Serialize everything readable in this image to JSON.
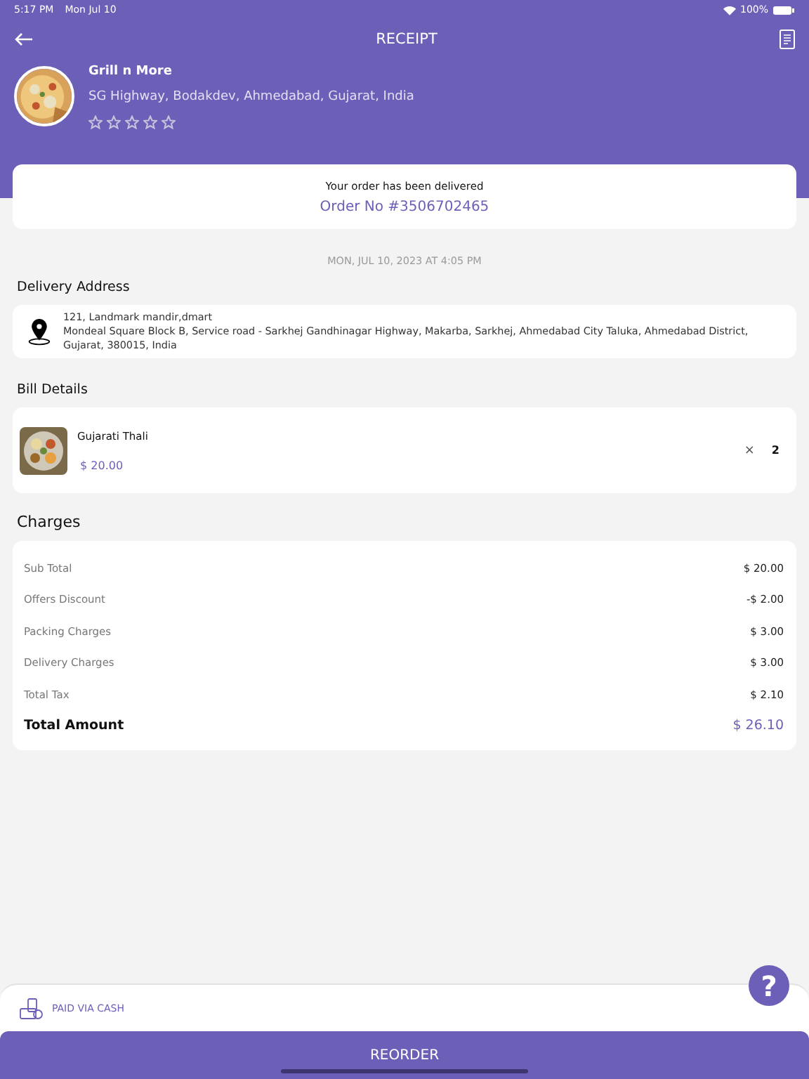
{
  "status_bar": {
    "time": "5:17 PM",
    "date": "Mon Jul 10",
    "battery": "100%"
  },
  "header": {
    "title": "RECEIPT"
  },
  "restaurant": {
    "name": "Grill n More",
    "address": "SG Highway, Bodakdev, Ahmedabad, Gujarat, India",
    "stars": 0
  },
  "order": {
    "status": "Your order has been delivered",
    "number": "Order No #3506702465",
    "date": "MON, JUL 10, 2023 AT 4:05 PM"
  },
  "delivery": {
    "heading": "Delivery Address",
    "lines": [
      "121, Landmark mandir,dmart",
      "Mondeal Square Block B, Service road - Sarkhej Gandhinagar Highway, Makarba, Sarkhej, Ahmedabad City Taluka, Ahmedabad District, Gujarat, 380015, India"
    ]
  },
  "bill": {
    "heading": "Bill Details",
    "items": [
      {
        "name": "Gujarati Thali",
        "price": "$ 20.00",
        "times": "×",
        "quantity": "2"
      }
    ]
  },
  "charges": {
    "heading": "Charges",
    "rows": [
      {
        "label": "Sub Total",
        "value": "$ 20.00"
      },
      {
        "label": "Offers Discount",
        "value": "-$ 2.00"
      },
      {
        "label": "Packing Charges",
        "value": "$ 3.00"
      },
      {
        "label": "Delivery Charges",
        "value": "$ 3.00"
      },
      {
        "label": "Total Tax",
        "value": "$ 2.10"
      }
    ],
    "total": {
      "label": "Total Amount",
      "value": "$ 26.10"
    }
  },
  "payment": {
    "label": "PAID VIA CASH"
  },
  "help": {
    "symbol": "?"
  },
  "reorder": {
    "label": "REORDER"
  }
}
